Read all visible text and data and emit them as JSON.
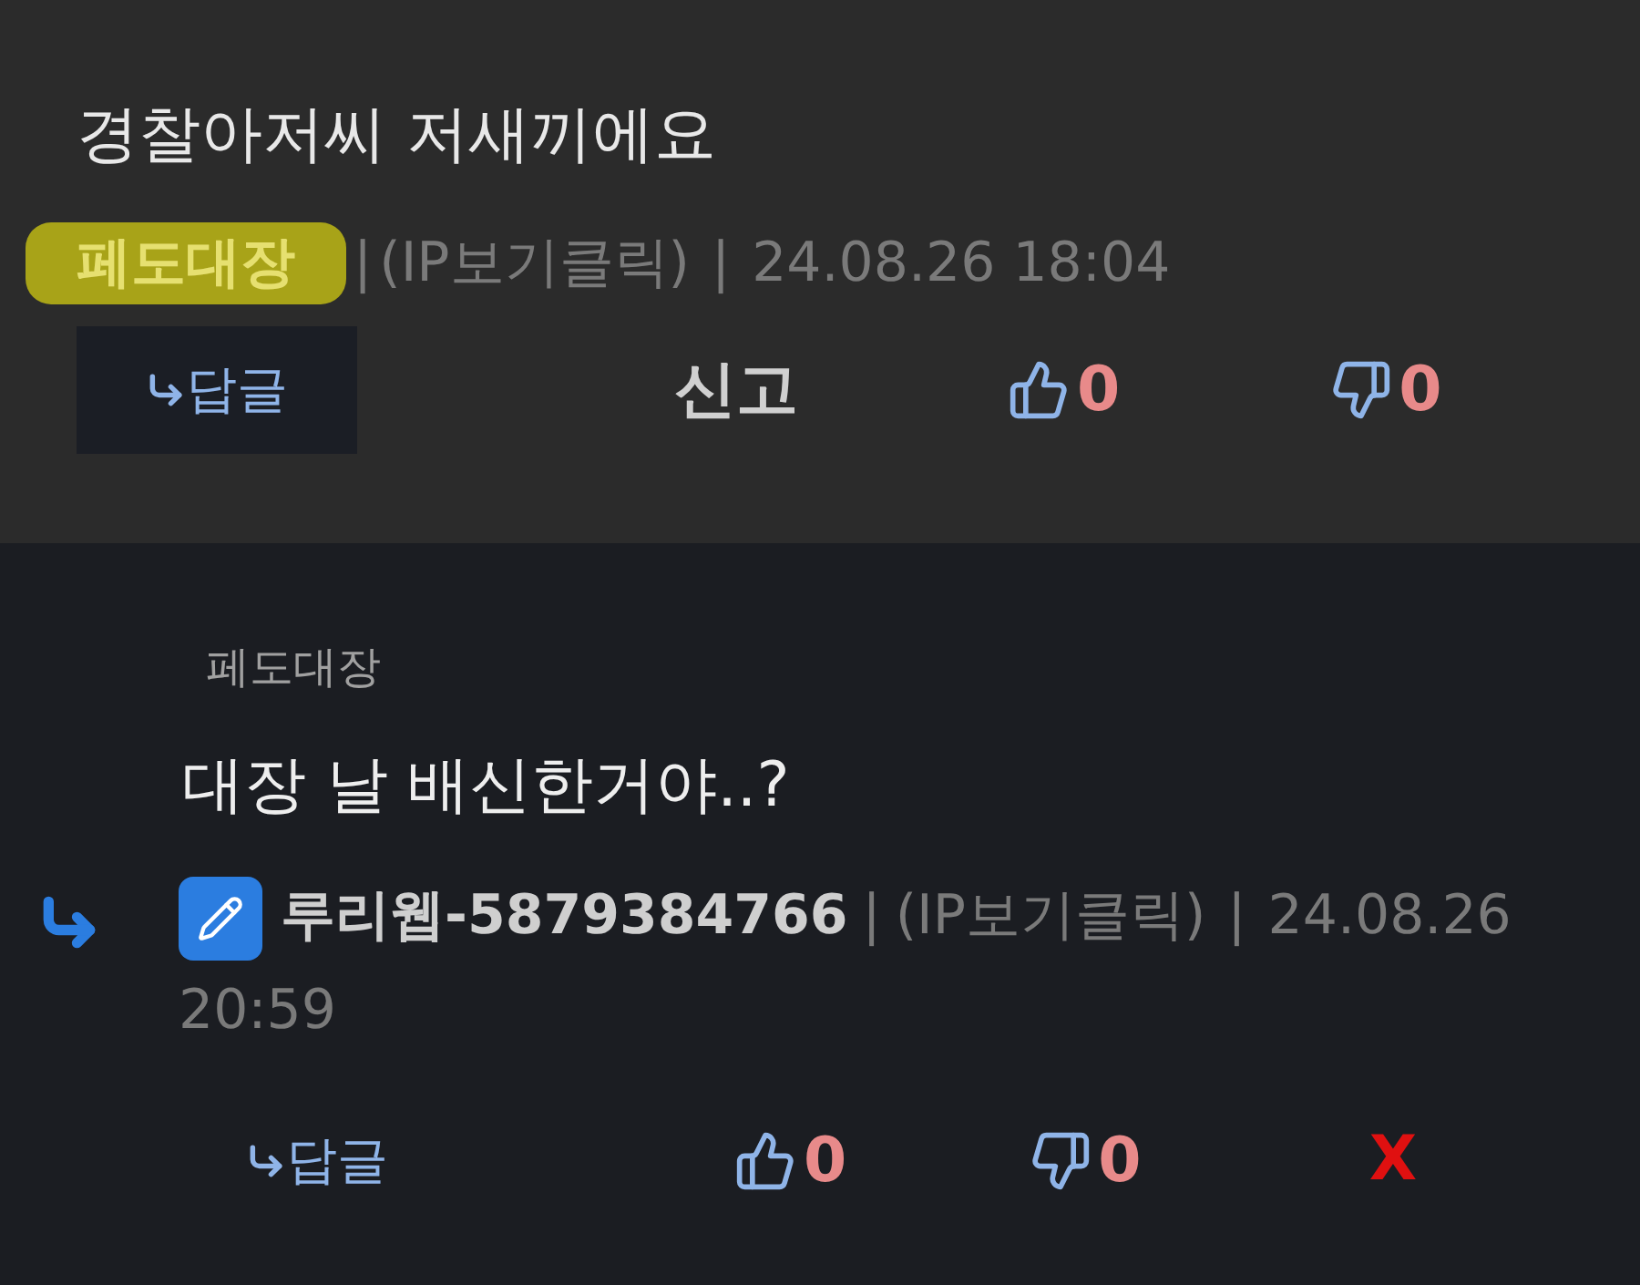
{
  "comment": {
    "text": "경찰아저씨 저새끼에요",
    "author": "페도대장",
    "highlighted": true,
    "separators": [
      "|",
      "|"
    ],
    "ip": "(IP보기클릭)",
    "date": "24.08.26 18:04",
    "reply_button": "답글",
    "report": "신고",
    "likes": "0",
    "dislikes": "0"
  },
  "reply": {
    "parent_author": "페도대장",
    "text": "대장 날 배신한거야..?",
    "author": "루리웹-5879384766",
    "separators": [
      "|",
      "|"
    ],
    "ip": "(IP보기클릭)",
    "date": "24.08.26",
    "time": "20:59",
    "reply_button": "답글",
    "likes": "0",
    "dislikes": "0",
    "delete": "X"
  }
}
